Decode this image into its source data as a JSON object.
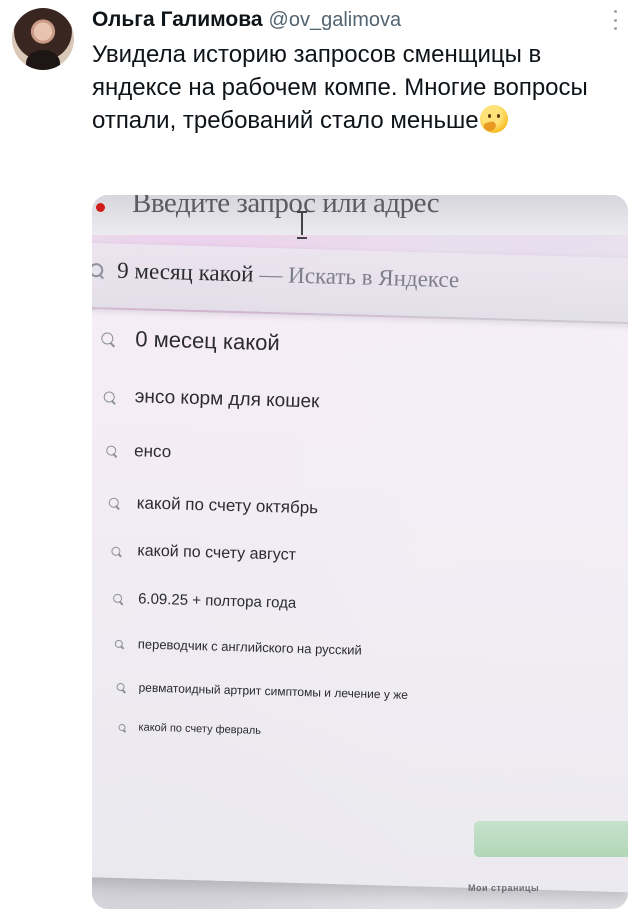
{
  "tweet": {
    "display_name": "Ольга Галимова",
    "handle": "@ov_galimova",
    "text": "Увидела историю запросов сменщицы в яндексе на рабочем компе. Многие вопросы отпали, требований стало меньше",
    "emoji": "thinking-face-emoji"
  },
  "photo": {
    "address_placeholder": "Введите запрос или адрес",
    "first_suggestion": {
      "query": "9 месяц какой",
      "hint": "— Искать в Яндексе"
    },
    "history": [
      "0 месец какой",
      "энсо корм для кошек",
      "енсо",
      "какой по счету октябрь",
      "какой по счету август",
      "6.09.25 + полтора года",
      "переводчик с английского на русский",
      "ревматоидный артрит симптомы и лечение у же",
      "какой по счету февраль"
    ],
    "footer_link": "Мои страницы"
  },
  "colors": {
    "accent_green": "#a8d3ae",
    "handle_gray": "#536471",
    "browser_dot_red": "#d21c1c"
  }
}
